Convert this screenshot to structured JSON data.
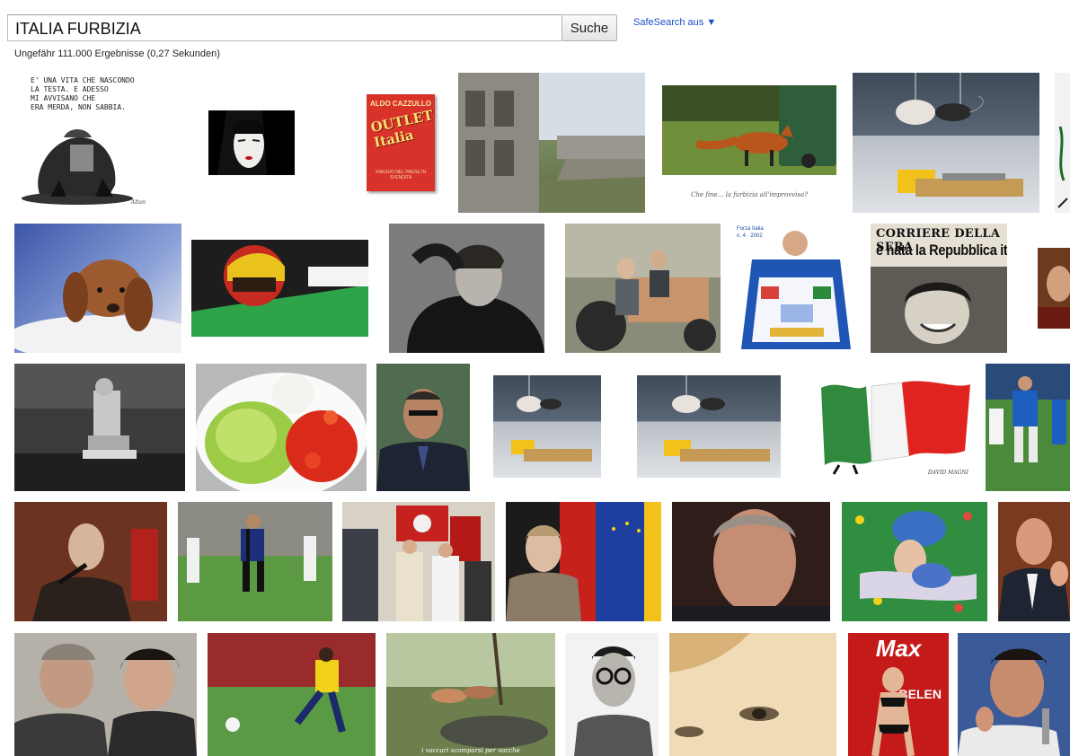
{
  "search": {
    "query": "ITALIA FURBIZIA",
    "button_label": "Suche"
  },
  "safesearch": {
    "label": "SafeSearch aus",
    "arrow": "▼"
  },
  "result_stats": "Ungefähr 111.000 Ergebnisse (0,27 Sekunden)",
  "thumbnails": {
    "cartoon_text": "E' UNA VITA CHE NASCONDO\nLA TESTA. E ADESSO\nMI AVVISANO CHE\nERA MERDA, NON SABBIA.",
    "book_author": "ALDO CAZZULLO",
    "book_title": "OUTLET\nItalia",
    "book_subtitle": "VIAGGIO NEL PAESE IN SVENDITA",
    "fox_caption": "Che fine... la furbizia all'improvvisa?",
    "forza_label": "Forza Italia\nn. 4 · 2002",
    "newspaper_masthead": "CORRIERE DELLA SERA",
    "newspaper_headline": "è nata la Repubblica italiana",
    "flag_signature": "DAVID MAGNI",
    "woods_caption": "i vaccari scomparsi per vacche",
    "magazine_title": "Max",
    "magazine_name": "BELEN"
  }
}
